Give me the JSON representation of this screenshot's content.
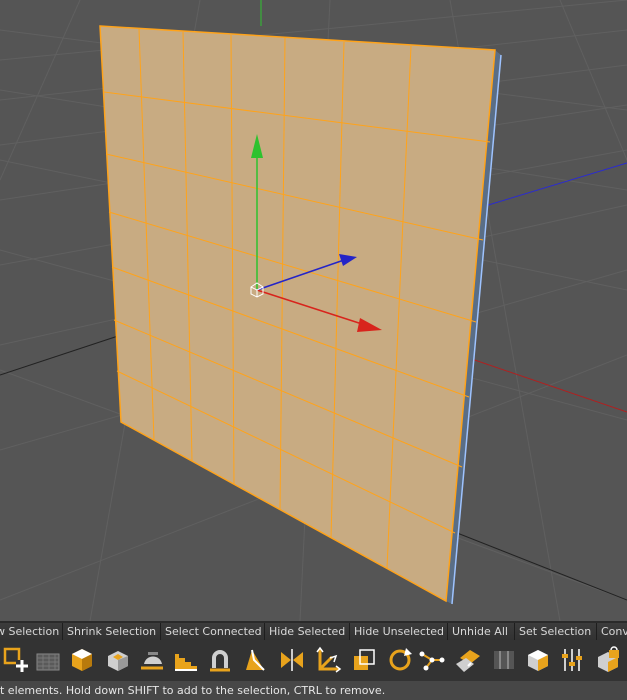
{
  "command_bar": {
    "buttons": [
      "w Selection",
      "Shrink Selection",
      "Select Connected",
      "Hide Selected",
      "Hide Unselected",
      "Unhide All",
      "Set Selection",
      "Conv"
    ]
  },
  "toolbar": {
    "tools": [
      {
        "icon": "add-object-icon"
      },
      {
        "icon": "layer-grid-icon"
      },
      {
        "icon": "extrude-cube-icon"
      },
      {
        "icon": "bevel-cube-icon"
      },
      {
        "icon": "iron-tool-icon"
      },
      {
        "icon": "stairs-tool-icon"
      },
      {
        "icon": "bend-tool-icon"
      },
      {
        "icon": "magnet-tool-icon"
      },
      {
        "icon": "brush-tool-icon"
      },
      {
        "icon": "mirror-tool-icon"
      },
      {
        "icon": "move-axis-icon"
      },
      {
        "icon": "scale-tool-icon"
      },
      {
        "icon": "rotate-tool-icon"
      },
      {
        "icon": "points-path-icon"
      },
      {
        "icon": "weld-tool-icon"
      },
      {
        "icon": "slide-tool-icon"
      },
      {
        "icon": "cube-box-icon"
      },
      {
        "icon": "sliders-icon"
      },
      {
        "icon": "cube-lock-icon"
      }
    ]
  },
  "status": {
    "text": "t elements. Hold down SHIFT to add to the selection, CTRL to remove."
  },
  "colors": {
    "viewport_bg": "#555555",
    "plane_fill": "#c8ab82",
    "wireframe": "#ffa31a",
    "axis_x": "#d8241c",
    "axis_y": "#2ec22e",
    "axis_z": "#2424c8"
  }
}
